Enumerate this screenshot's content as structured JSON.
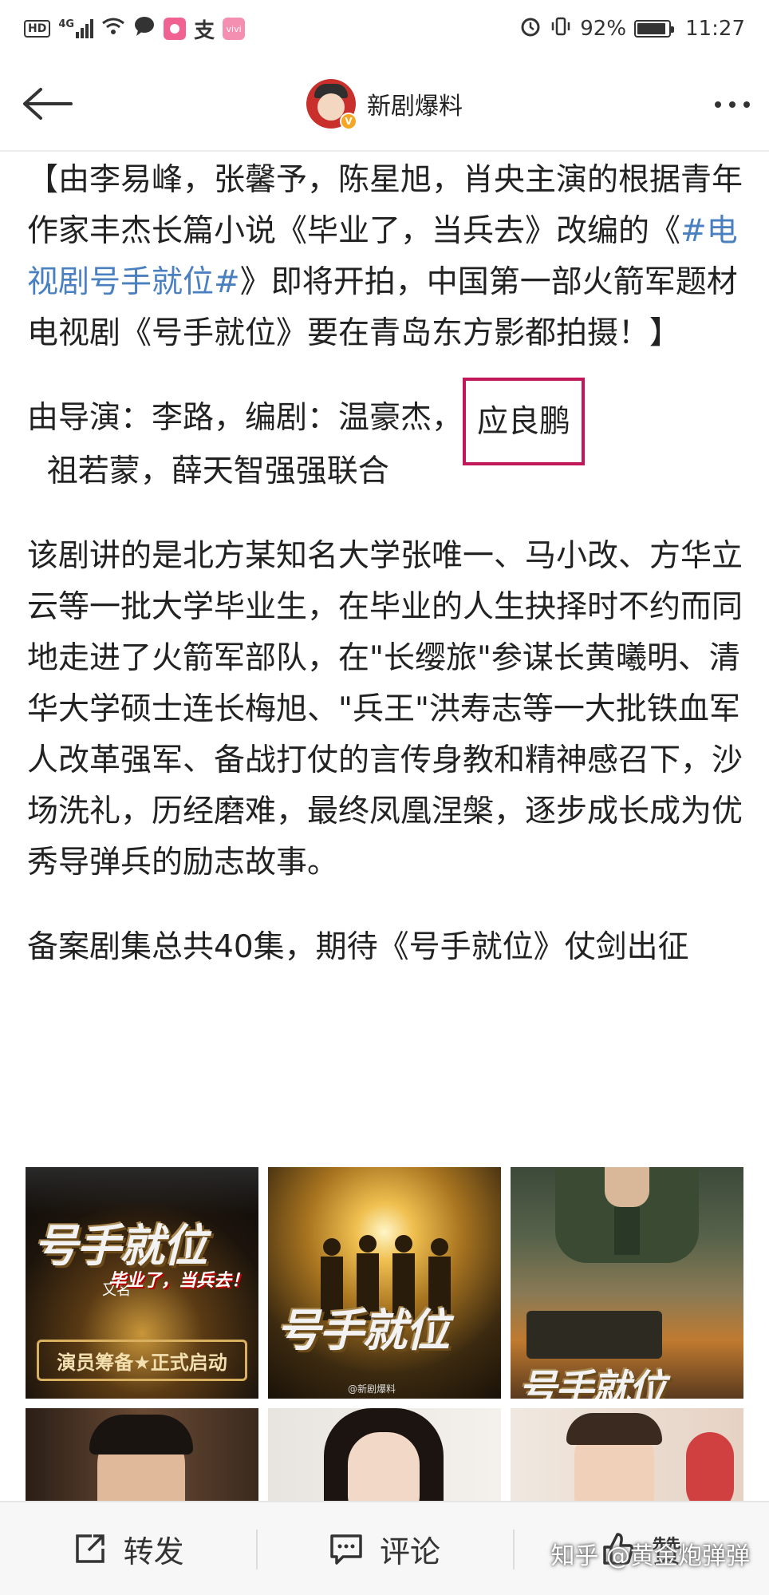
{
  "status_bar": {
    "hd": "HD",
    "network": "4G",
    "app_icon_1": "支",
    "app_icon_2": "vivi",
    "battery": "92%",
    "battery_level": 0.92,
    "time": "11:27"
  },
  "nav": {
    "title": "新剧爆料"
  },
  "post": {
    "p1_before": "【由李易峰，张馨予，陈星旭，肖央主演的根据青年作家丰杰长篇小说《毕业了，当兵去》改编的《",
    "p1_hashtag": "#电视剧号手就位#",
    "p1_after": "》即将开拍，中国第一部火箭军题材电视剧《号手就位》要在青岛东方影都拍摄！】",
    "p2_before": "由导演：李路，编剧：温豪杰，",
    "p2_boxed": "应良鹏",
    "p2_after": "  祖若蒙，薛天智强强联合",
    "p3": "该剧讲的是北方某知名大学张唯一、马小改、方华立云等一批大学毕业生，在毕业的人生抉择时不约而同地走进了火箭军部队，在\"长缨旅\"参谋长黄曦明、清华大学硕士连长梅旭、\"兵王\"洪寿志等一大批铁血军人改革强军、备战打仗的言传身教和精神感召下，沙场洗礼，历经磨难，最终凤凰涅槃，逐步成长成为优秀导弹兵的励志故事。",
    "p4": "备案剧集总共40集，期待《号手就位》仗剑出征"
  },
  "images": {
    "poster1_title": "号手就位",
    "poster1_sub": "毕业了，当兵去！",
    "poster1_alias": "又名",
    "poster1_banner": "演员筹备★正式启动",
    "poster2_title": "号手就位",
    "poster2_wm": "@新剧爆料",
    "poster3_title": "号手就位"
  },
  "actions": {
    "repost": "转发",
    "comment": "评论",
    "like": "赞"
  },
  "watermark": "知乎 @黄金炮弹弹"
}
